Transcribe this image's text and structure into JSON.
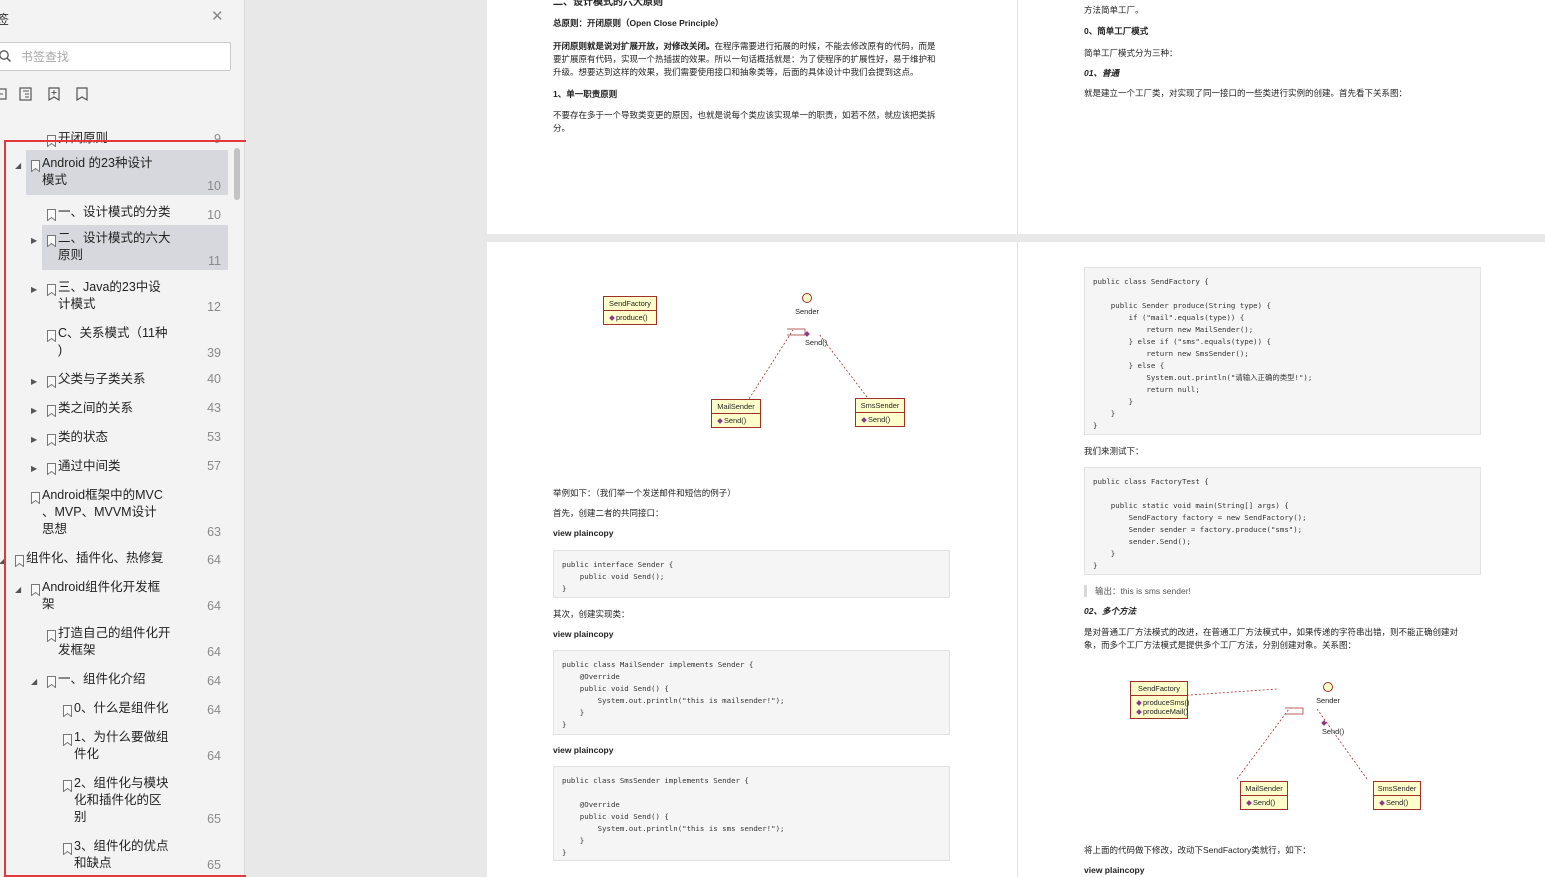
{
  "sidebar": {
    "title": "签",
    "search_placeholder": "书签查找",
    "items": [
      {
        "label": "开闭原则",
        "page": "9",
        "bookmark": true
      },
      {
        "label": "Android 的23种设计\n模式",
        "page": "10",
        "arrow": "expanded",
        "selected": true
      },
      {
        "label": "一、设计模式的分类",
        "page": "10"
      },
      {
        "label": "二、设计模式的六大\n原则",
        "page": "11",
        "arrow": "collapsed",
        "selected": true
      },
      {
        "label": "三、Java的23中设\n计模式",
        "page": "12",
        "arrow": "collapsed"
      },
      {
        "label": "C、关系模式（11种\n)",
        "page": "39"
      },
      {
        "label": "父类与子类关系",
        "page": "40",
        "arrow": "collapsed"
      },
      {
        "label": "类之间的关系",
        "page": "43",
        "arrow": "collapsed"
      },
      {
        "label": "类的状态",
        "page": "53",
        "arrow": "collapsed"
      },
      {
        "label": "通过中间类",
        "page": "57",
        "arrow": "collapsed"
      },
      {
        "label": "Android框架中的MVC\n、MVP、MVVM设计\n思想",
        "page": "63"
      },
      {
        "label": "组件化、插件化、热修复",
        "page": "64",
        "arrow": "expanded"
      },
      {
        "label": "Android组件化开发框\n架",
        "page": "64",
        "arrow": "expanded"
      },
      {
        "label": "打造自己的组件化开\n发框架",
        "page": "64"
      },
      {
        "label": "一、组件化介绍",
        "page": "64",
        "arrow": "expanded"
      },
      {
        "label": "0、什么是组件化",
        "page": "64"
      },
      {
        "label": "1、为什么要做组\n件化",
        "page": "64"
      },
      {
        "label": "2、组件化与模块\n化和插件化的区\n别",
        "page": "65"
      },
      {
        "label": "3、组件化的优点\n和缺点",
        "page": "65"
      }
    ]
  },
  "page1_left": {
    "heading": "二、设计模式的六大原则",
    "principle": "总原则：开闭原则（Open Close Principle）",
    "para_a": "开闭原则就是说对扩展开放，对修改关闭。",
    "para_b": "在程序需要进行拓展的时候，不能去修改原有的代码，而是",
    "para_c": "要扩展原有代码，实现一个热插拔的效果。所以一句话概括就是：为了使程序的扩展性好，易于维护和",
    "para_d": "升级。想要达到这样的效果，我们需要使用接口和抽象类等，后面的具体设计中我们会提到这点。",
    "section1": "1、单一职责原则",
    "para2_a": "不要存在多于一个导致类变更的原因，也就是说每个类应该实现单一的职责，如若不然，就应该把类拆",
    "para2_b": "分。"
  },
  "page1_right": {
    "line0": "方法简单工厂。",
    "section0": "0、简单工厂模式",
    "line1": "简单工厂模式分为三种：",
    "sub01": "01、普通",
    "line2": "就是建立一个工厂类，对实现了同一接口的一些类进行实例的创建。首先看下关系图："
  },
  "page2_left": {
    "example": "举例如下：（我们举一个发送邮件和短信的例子）",
    "first": "首先，创建二者的共同接口：",
    "view_plain_1": "view plaincopy",
    "code1": "public interface Sender {\n    public void Send();\n}",
    "second": "其次，创建实现类：",
    "view_plain_2": "view plaincopy",
    "code2": "public class MailSender implements Sender {\n    @Override\n    public void Send() {\n        System.out.println(\"this is mailsender!\");\n    }\n}",
    "view_plain_3": "view plaincopy",
    "code3": "public class SmsSender implements Sender {\n\n    @Override\n    public void Send() {\n        System.out.println(\"this is sms sender!\");\n    }\n}",
    "uml": {
      "factory": "SendFactory",
      "factory_op": "produce()",
      "iface": "Sender",
      "iface_op": "Send()",
      "mail": "MailSender",
      "mail_op": "Send()",
      "sms": "SmsSender",
      "sms_op": "Send()"
    }
  },
  "page2_right": {
    "code4": "public class SendFactory {\n\n    public Sender produce(String type) {\n        if (\"mail\".equals(type)) {\n            return new MailSender();\n        } else if (\"sms\".equals(type)) {\n            return new SmsSender();\n        } else {\n            System.out.println(\"请输入正确的类型!\");\n            return null;\n        }\n    }\n}",
    "test_intro": "我们来测试下：",
    "code5": "public class FactoryTest {\n\n    public static void main(String[] args) {\n        SendFactory factory = new SendFactory();\n        Sender sender = factory.produce(\"sms\");\n        sender.Send();\n    }\n}",
    "output": "输出：this is sms sender!",
    "sub02": "02、多个方法",
    "para_a": "是对普通工厂方法模式的改进，在普通工厂方法模式中，如果传递的字符串出错，则不能正确创建对",
    "para_b": "象，而多个工厂方法模式是提供多个工厂方法，分别创建对象。关系图：",
    "uml": {
      "factory": "SendFactory",
      "factory_op1": "produceSms()",
      "factory_op2": "produceMail()",
      "iface": "Sender",
      "iface_op": "Send()",
      "mail": "MailSender",
      "mail_op": "Send()",
      "sms": "SmsSender",
      "sms_op": "Send()"
    },
    "modify": "将上面的代码做下修改，改动下SendFactory类就行，如下：",
    "view_plain": "view plaincopy"
  },
  "colors": {
    "highlight_box": "#e23a3a",
    "selected_row": "#d6d8dd",
    "uml_fill": "#ffffcc",
    "uml_border": "#a0302a"
  }
}
